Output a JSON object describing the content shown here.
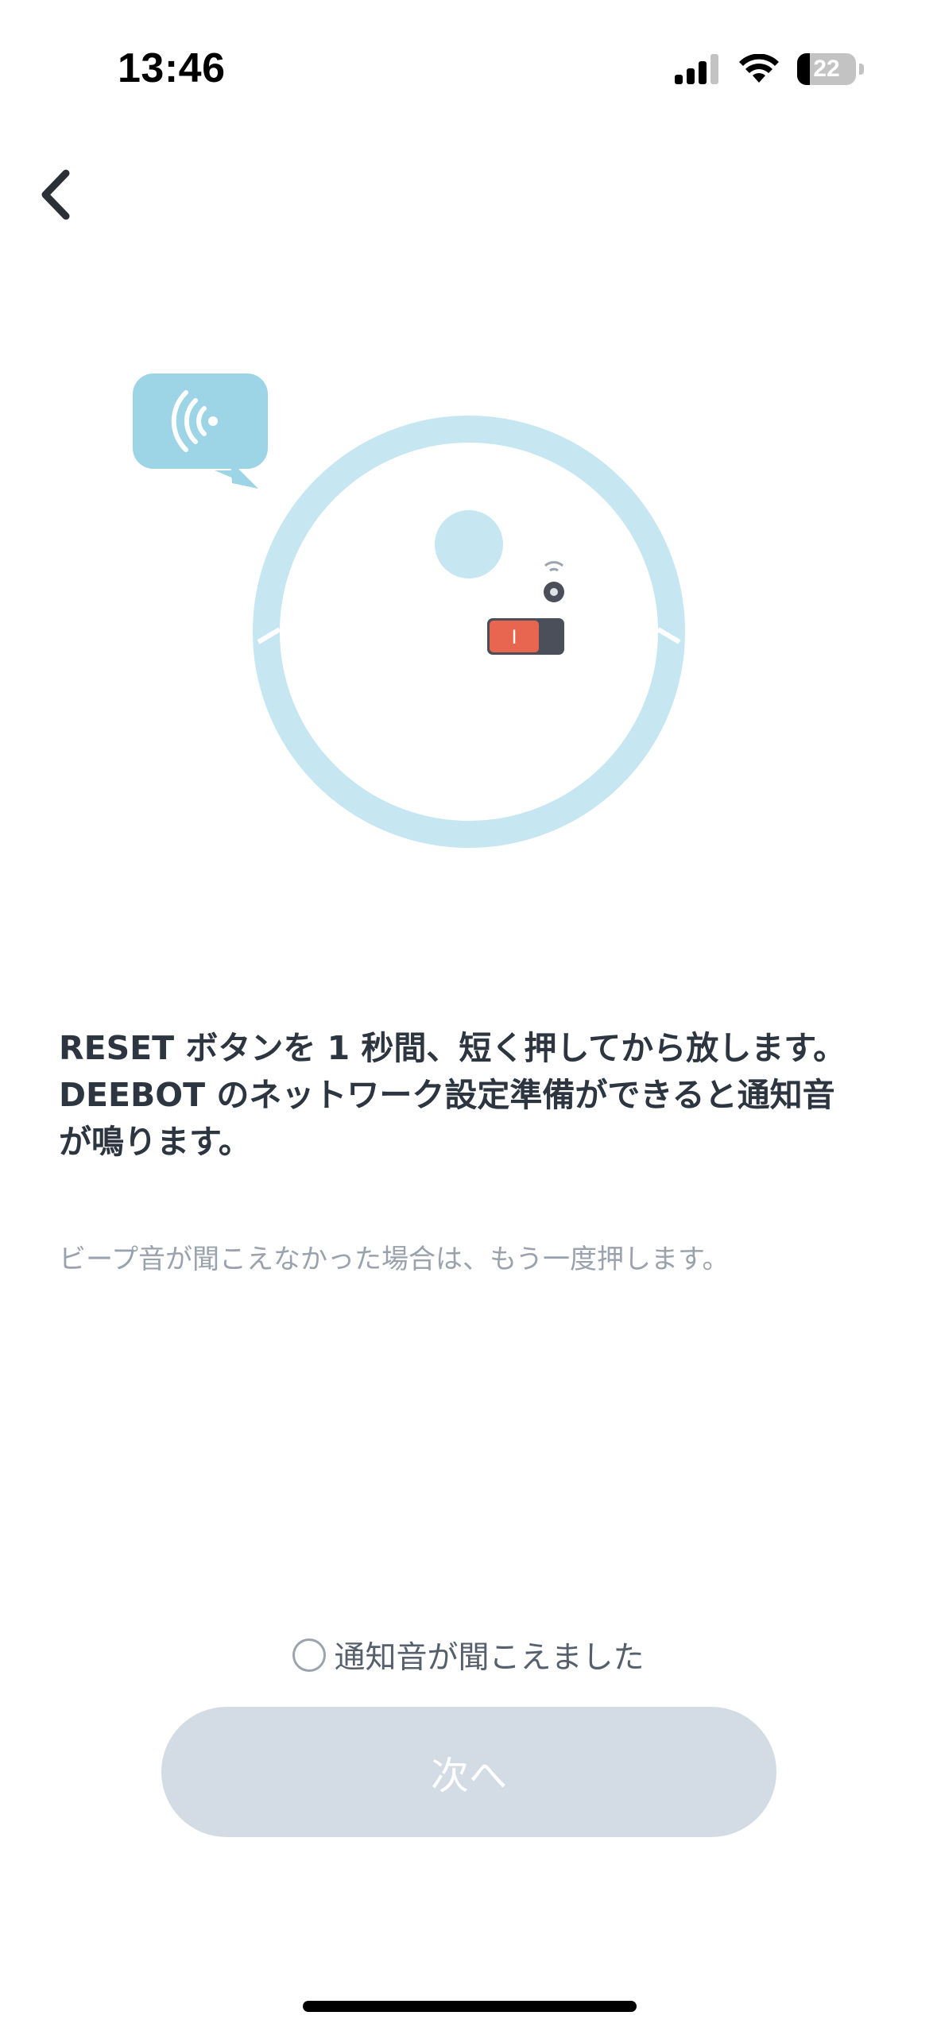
{
  "status_bar": {
    "time": "13:46",
    "battery_level": "22",
    "battery_fraction": 0.22,
    "icons": [
      "cellular-signal-icon",
      "wifi-icon",
      "battery-icon"
    ]
  },
  "nav": {
    "back_icon": "chevron-left-icon"
  },
  "illustration": {
    "speech_bubble_icon": "sound-waves-icon",
    "robot_icon": "robot-vacuum-icon",
    "switch_label": "I",
    "colors": {
      "robot_light": "#c6e6f1",
      "bubble": "#9dd4e6",
      "switch_on": "#e8664f",
      "switch_body": "#4a4f59"
    }
  },
  "content": {
    "instruction": "RESET ボタンを 1 秒間、短く押してから放します。DEEBOT のネットワーク設定準備ができると通知音が鳴ります。",
    "hint": "ビープ音が聞こえなかった場合は、もう一度押します。"
  },
  "confirm": {
    "label": "通知音が聞こえました",
    "checked": false
  },
  "footer": {
    "next_label": "次へ",
    "next_enabled": false,
    "next_color": "#d3dce4"
  }
}
